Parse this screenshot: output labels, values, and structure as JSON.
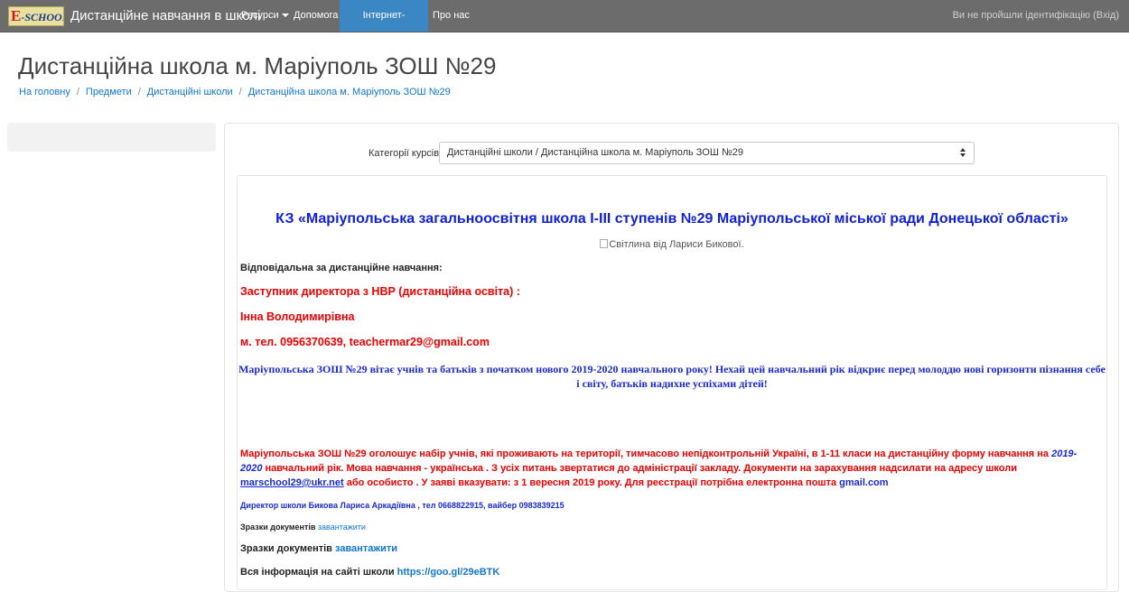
{
  "navbar": {
    "logo_e": "E",
    "logo_text": "-SCHOOL",
    "brand": "Дистанційне навчання в школі",
    "items": [
      {
        "label": "Ресурси"
      },
      {
        "label": "Допомога"
      },
      {
        "label": "Інтернет-олімпіади"
      },
      {
        "label": "Про нас"
      }
    ],
    "login": "Ви не пройшли ідентифікацію (Вхід)",
    "colors": {
      "bar": "#6c6c6c",
      "active": "#3a87c4"
    }
  },
  "header": {
    "title": "Дистанційна школа м. Маріуполь ЗОШ №29",
    "breadcrumb": [
      "На головну",
      "Предмети",
      "Дистанційні школи",
      "Дистанційна школа м. Маріуполь ЗОШ №29"
    ]
  },
  "category": {
    "label": "Категорії курсів:",
    "selected": "Дистанційні школи / Дистанційна школа м. Маріуполь ЗОШ №29"
  },
  "content": {
    "heading": "КЗ «Маріупольська загальноосвітня школа І-ІІІ ступенів №29 Маріупольської міської ради Донецької області»",
    "image_alt": "Світлина від Лариси Бикової.",
    "responsible": "Відповідальна  за дистанційне навчання:",
    "deputy": "Заступник директора з НВР  (дистанційна освіта) :",
    "name": "Інна Володимирівна",
    "phone": "м. тел. 0956370639, teachermar29@gmail.com",
    "greeting": "Маріупольська ЗОШ №29 вітає  учнів та батьків з початком нового 2019-2020 навчального року! Нехай цей навчальний рік відкриє перед молоддю нові горизонти пізнання себе і світу, батьків надихне успіхами дітей!",
    "announcement_1": "Маріупольська ЗОШ №29   оголошує набір учнів, які проживають на території, тимчасово непідконтрольній Україні, в 1-11 класи на дистанційну форму навчання на ",
    "announcement_year": "2019-2020",
    "announcement_2": " навчальний рік.   Мова навчання - українська .  З усіх питань звертатися до адміністрації закладу. Документи на зарахування надсилати на адресу школи  ",
    "announcement_email": "marschool29@ukr.net",
    "announcement_3": " або особисто  . У заяві вказувати: з 1 вересня 2019 року. Для реєстрації потрібна електронна пошта ",
    "announcement_gmail": "gmail.com",
    "director": "Директор школи Бикова Лариса Аркадіївна , тел 0668822915,  вайбер 0983839215",
    "docs_label": "Зразки документів ",
    "docs_link": "завантажити",
    "info_label": "Вся інформація на сайті школи  ",
    "info_link": "https://goo.gl/29eBTK"
  }
}
